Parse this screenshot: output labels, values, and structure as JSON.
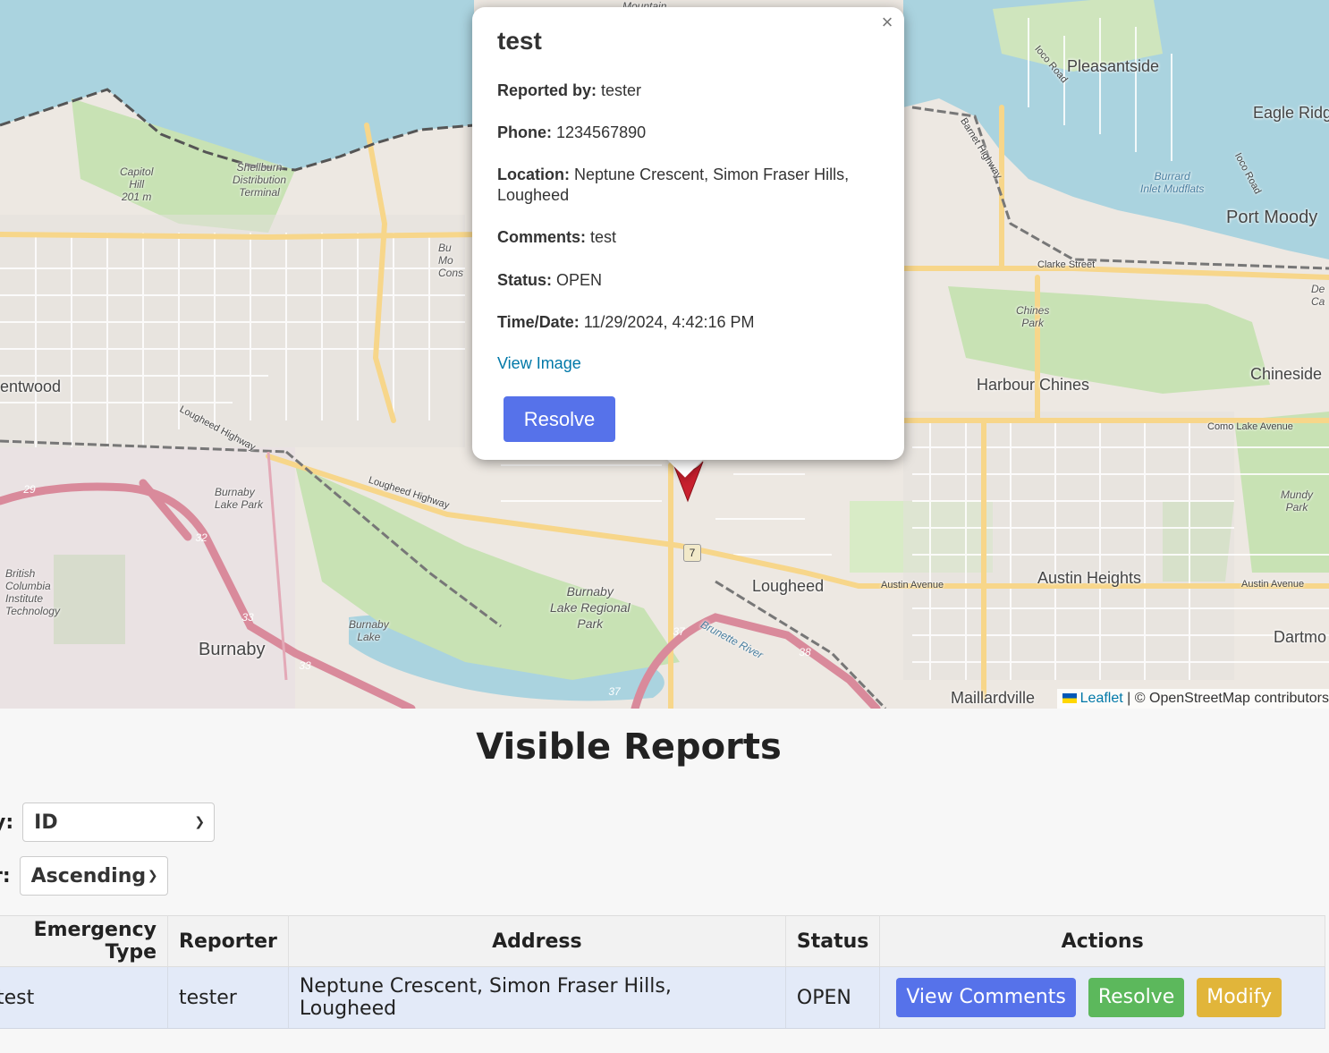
{
  "map": {
    "places": {
      "pleasantside": "Pleasantside",
      "eagle_ridge": "Eagle Ridg",
      "port_moody": "Port Moody",
      "harbour_chines": "Harbour Chines",
      "chineside": "Chineside",
      "capitol_hill": "Capitol\nHill\n201 m",
      "shellburn": "Shellburn\nDistribution\nTerminal",
      "entwood": "entwood",
      "burnaby_lake_park": "Burnaby\nLake Park",
      "burnaby": "Burnaby",
      "bcit": "British\nColumbia\nInstitute\nTechnology",
      "burnaby_lake": "Burnaby\nLake",
      "burnaby_lake_regional": "Burnaby\nLake Regional\nPark",
      "lougheed": "Lougheed",
      "austin_heights": "Austin Heights",
      "dartmo": "Dartmo",
      "maillardville": "Maillardville",
      "chines_park": "Chines\nPark",
      "mundy_park": "Mundy\nPark",
      "burrard_mudflats": "Burrard\nInlet Mudflats",
      "clarke_street": "Clarke Street",
      "como_lake": "Como Lake Avenue",
      "austin_avenue": "Austin Avenue",
      "austin_avenue_2": "Austin Avenue",
      "lougheed_hwy": "Lougheed Highway",
      "lougheed_hwy_2": "Lougheed Highway",
      "barnet_hwy": "Barnet Highway",
      "ioco_road": "Ioco Road",
      "ioco_road_2": "Ioco Road",
      "brunette_river": "Brunette River",
      "fragment_bu": "Bu\nMo\nCons",
      "mountain": "Mountain",
      "fragment_ca": "De\nCa"
    },
    "shields": {
      "s7": "7",
      "s29": "29",
      "s32": "32",
      "s33a": "33",
      "s33b": "33",
      "s37a": "37",
      "s37b": "37",
      "s38": "38"
    },
    "attribution": {
      "leaflet": "Leaflet",
      "separator": "|",
      "osm": "© OpenStreetMap contributors"
    }
  },
  "popup": {
    "title": "test",
    "fields": [
      {
        "label": "Reported by:",
        "value": "tester"
      },
      {
        "label": "Phone:",
        "value": "1234567890"
      },
      {
        "label": "Location:",
        "value": "Neptune Crescent, Simon Fraser Hills, Lougheed"
      },
      {
        "label": "Comments:",
        "value": "test"
      },
      {
        "label": "Status:",
        "value": "OPEN"
      },
      {
        "label": "Time/Date:",
        "value": "11/29/2024, 4:42:16 PM"
      }
    ],
    "view_image_label": "View Image",
    "resolve_label": "Resolve",
    "close_glyph": "×"
  },
  "reports": {
    "title": "Visible Reports",
    "sort_by": {
      "label": "y:",
      "selected": "ID"
    },
    "order": {
      "label": "r:",
      "selected": "Ascending"
    },
    "columns": [
      "Emergency Type",
      "Reporter",
      "Address",
      "Status",
      "Actions"
    ],
    "rows": [
      {
        "type": "test",
        "reporter": "tester",
        "address": "Neptune Crescent, Simon Fraser Hills, Lougheed",
        "status": "OPEN",
        "actions": {
          "view": "View Comments",
          "resolve": "Resolve",
          "modify": "Modify"
        }
      }
    ]
  },
  "colors": {
    "water": "#aad3df",
    "park": "#c8e2b4",
    "primary_road": "#f7d68a",
    "motorway": "#d98a9b",
    "button_blue": "#5672ea",
    "button_green": "#5cb85c",
    "button_yellow": "#e1b53a",
    "marker_red": "#c8202e"
  }
}
